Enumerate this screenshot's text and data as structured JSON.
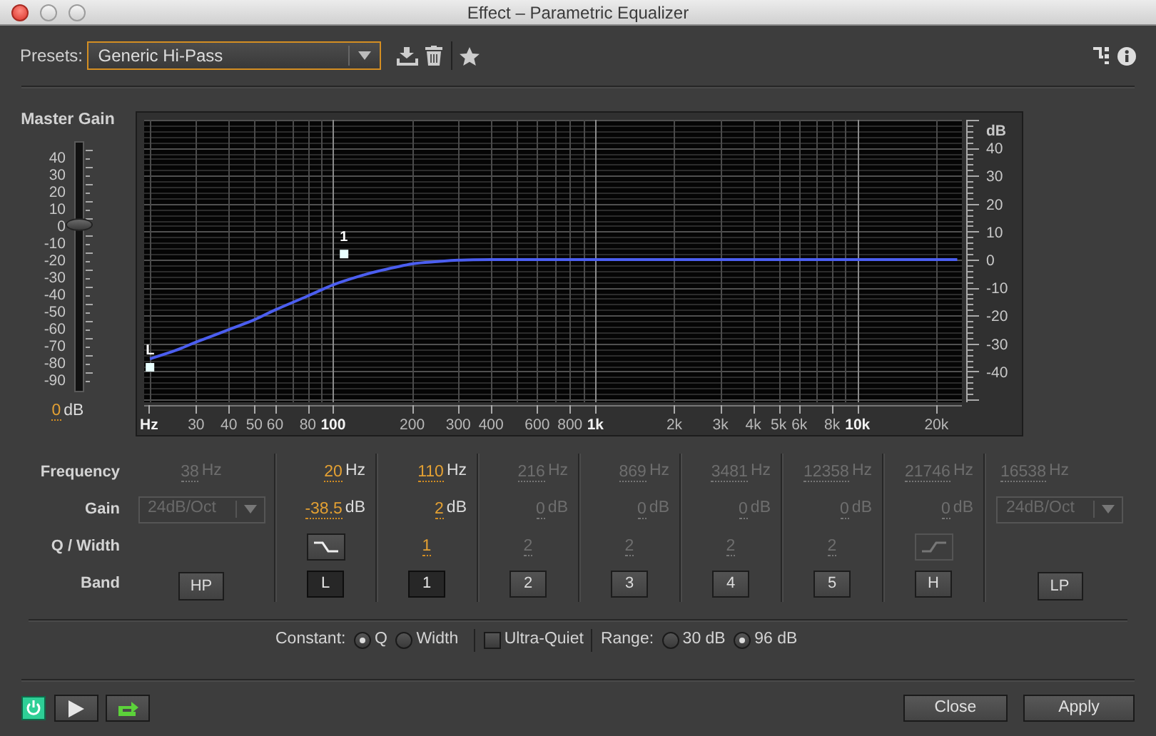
{
  "window": {
    "title": "Effect – Parametric Equalizer"
  },
  "presets": {
    "label": "Presets:",
    "value": "Generic Hi-Pass"
  },
  "master_gain": {
    "label": "Master Gain",
    "scale": [
      "40",
      "30",
      "20",
      "10",
      "0",
      "-10",
      "-20",
      "-30",
      "-40",
      "-50",
      "-60",
      "-70",
      "-80",
      "-90"
    ],
    "level": 0.66,
    "value": "0",
    "unit": "dB"
  },
  "graph": {
    "x_unit": "Hz",
    "y_unit": "dB",
    "handle_labels": [
      "L",
      "1"
    ],
    "x_labels": [
      "30",
      "40",
      "50",
      "60",
      "80",
      "100",
      "200",
      "300",
      "400",
      "600",
      "800",
      "1k",
      "2k",
      "3k",
      "4k",
      "5k",
      "6k",
      "8k",
      "10k",
      "20k"
    ],
    "y_labels": [
      "40",
      "30",
      "20",
      "10",
      "0",
      "-10",
      "-20",
      "-30",
      "-40"
    ]
  },
  "bands": {
    "row_labels": [
      "Frequency",
      "Gain",
      "Q / Width",
      "Band"
    ],
    "columns": [
      {
        "kind": "pass",
        "frequency": "38",
        "frequency_unit": "Hz",
        "slope": "24dB/Oct",
        "band": "HP",
        "on": false
      },
      {
        "kind": "low_shelf",
        "frequency": "20",
        "frequency_unit": "Hz",
        "gain": "-38.5",
        "gain_unit": "dB",
        "band": "L",
        "on": true
      },
      {
        "kind": "peak",
        "frequency": "110",
        "frequency_unit": "Hz",
        "gain": "2",
        "gain_unit": "dB",
        "q": "1",
        "band": "1",
        "on": true
      },
      {
        "kind": "peak",
        "frequency": "216",
        "frequency_unit": "Hz",
        "gain": "0",
        "gain_unit": "dB",
        "q": "2",
        "band": "2",
        "on": false
      },
      {
        "kind": "peak",
        "frequency": "869",
        "frequency_unit": "Hz",
        "gain": "0",
        "gain_unit": "dB",
        "q": "2",
        "band": "3",
        "on": false
      },
      {
        "kind": "peak",
        "frequency": "3481",
        "frequency_unit": "Hz",
        "gain": "0",
        "gain_unit": "dB",
        "q": "2",
        "band": "4",
        "on": false
      },
      {
        "kind": "peak",
        "frequency": "12358",
        "frequency_unit": "Hz",
        "gain": "0",
        "gain_unit": "dB",
        "q": "2",
        "band": "5",
        "on": false
      },
      {
        "kind": "high_shelf",
        "frequency": "21746",
        "frequency_unit": "Hz",
        "gain": "0",
        "gain_unit": "dB",
        "band": "H",
        "on": false
      },
      {
        "kind": "pass",
        "frequency": "16538",
        "frequency_unit": "Hz",
        "slope": "24dB/Oct",
        "band": "LP",
        "on": false
      }
    ]
  },
  "options": {
    "constant_label": "Constant:",
    "constant": [
      {
        "label": "Q",
        "selected": true
      },
      {
        "label": "Width",
        "selected": false
      }
    ],
    "ultra_quiet": {
      "label": "Ultra-Quiet",
      "checked": false
    },
    "range_label": "Range:",
    "range": [
      {
        "label": "30 dB",
        "selected": false
      },
      {
        "label": "96 dB",
        "selected": true
      }
    ]
  },
  "footer": {
    "power_on": true,
    "buttons": [
      "Close",
      "Apply"
    ]
  }
}
